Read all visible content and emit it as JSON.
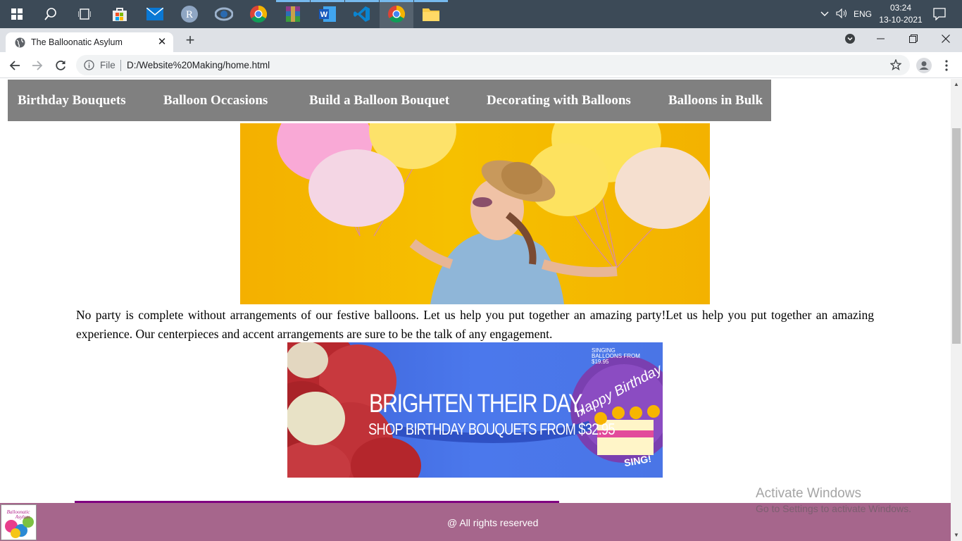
{
  "taskbar": {
    "icons": [
      "windows-start-icon",
      "search-icon",
      "task-view-icon",
      "store-icon",
      "mail-icon",
      "r-app-icon",
      "rstudio-icon",
      "chrome-icon",
      "winrar-icon",
      "word-icon",
      "vscode-icon",
      "chrome-active-icon",
      "file-explorer-icon"
    ],
    "language": "ENG",
    "time": "03:24",
    "date": "13-10-2021"
  },
  "browser": {
    "tab_title": "The Balloonatic Asylum",
    "omnibox_scheme": "File",
    "url": "D:/Website%20Making/home.html"
  },
  "page": {
    "nav": [
      "Birthday Bouquets",
      "Balloon Occasions",
      "Build a Balloon Bouquet",
      "Decorating with Balloons",
      "Balloons in Bulk"
    ],
    "intro_text": "No party is complete without arrangements of our festive balloons. Let us help you put together an amazing party!Let us help you put together an amazing experience. Our centerpieces and accent arrangements are sure to be the talk of any engagement.",
    "banner": {
      "headline": "BRIGHTEN THEIR DAY,",
      "subline": "SHOP BIRTHDAY BOUQUETS FROM $32.95",
      "corner": "SINGING BALLOONS FROM $19.95",
      "balloon_text": "Happy Birthday",
      "sing_text": "SING!"
    },
    "footer_text": "@ All rights reserved",
    "footer_logo_text": "Balloonatic Asylum"
  },
  "watermark": {
    "title": "Activate Windows",
    "subtitle": "Go to Settings to activate Windows."
  },
  "colors": {
    "taskbar": "#3c4a57",
    "nav_bg": "#808080",
    "footer_bg": "#a6668c",
    "purple_rule": "#800080"
  }
}
